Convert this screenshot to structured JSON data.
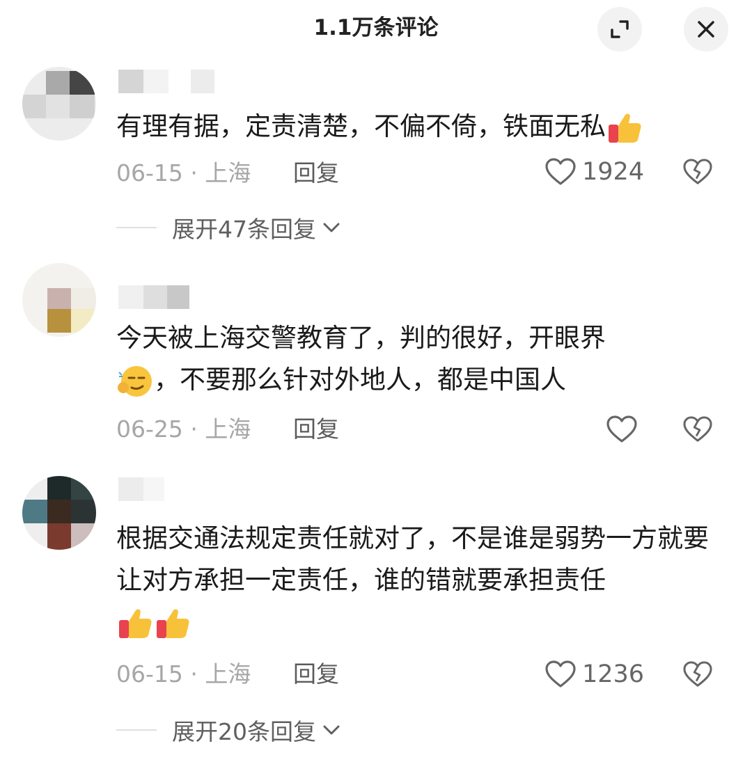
{
  "header": {
    "title": "1.1万条评论",
    "expand_icon": "expand-icon",
    "close_icon": "close-icon"
  },
  "comments": [
    {
      "text": "有理有据，定责清楚，不偏不倚，铁面无私",
      "emojis": [
        "thumbs-up"
      ],
      "date": "06-15",
      "location": "上海",
      "reply_label": "回复",
      "likes": "1924",
      "expand_replies": "展开47条回复"
    },
    {
      "text_line1": "今天被上海交警教育了，判的很好，开眼界",
      "text_line2": "，不要那么针对外地人，都是中国人",
      "emojis": [
        "smirk-face"
      ],
      "date": "06-25",
      "location": "上海",
      "reply_label": "回复",
      "likes": ""
    },
    {
      "text": "根据交通法规定责任就对了，不是谁是弱势一方就要让对方承担一定责任，谁的错就要承担责任",
      "emojis": [
        "thumbs-up",
        "thumbs-up"
      ],
      "date": "06-15",
      "location": "上海",
      "reply_label": "回复",
      "likes": "1236",
      "expand_replies": "展开20条回复"
    }
  ],
  "separator": "·"
}
